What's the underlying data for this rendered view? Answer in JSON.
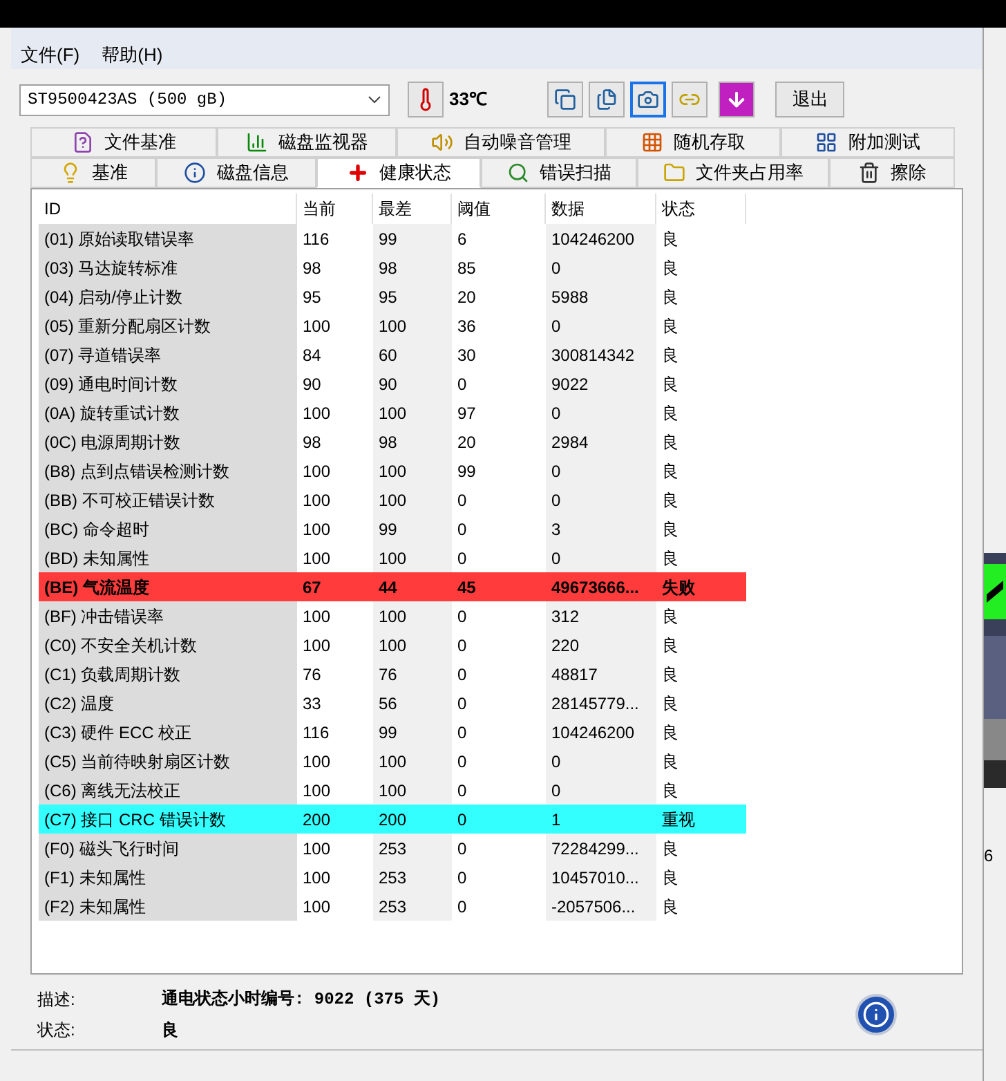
{
  "menu": [
    "文件(F)",
    "帮助(H)"
  ],
  "toolbar": {
    "drive": "ST9500423AS (500 gB)",
    "temperature": "33℃",
    "buttons": [
      {
        "selected": false
      },
      {
        "selected": false
      },
      {
        "selected": true
      },
      {
        "selected": false
      },
      {
        "selected": false
      }
    ],
    "exit": "退出"
  },
  "tabs_back": [
    {
      "label": "文件基准",
      "selected": false
    },
    {
      "label": "磁盘监视器",
      "selected": false
    },
    {
      "label": "自动噪音管理",
      "selected": false
    },
    {
      "label": "随机存取",
      "selected": false
    },
    {
      "label": "附加测试",
      "selected": false
    }
  ],
  "tabs_front": [
    {
      "label": "基准",
      "selected": false
    },
    {
      "label": "磁盘信息",
      "selected": false
    },
    {
      "label": "健康状态",
      "selected": true
    },
    {
      "label": "错误扫描",
      "selected": false
    },
    {
      "label": "文件夹占用率",
      "selected": false
    },
    {
      "label": "擦除",
      "selected": false
    }
  ],
  "table": {
    "columns": [
      "ID",
      "当前",
      "最差",
      "阈值",
      "数据",
      "状态"
    ],
    "rows": [
      {
        "kind": "normal",
        "cells": [
          "(01) 原始读取错误率",
          "116",
          "99",
          "6",
          "104246200",
          "良"
        ]
      },
      {
        "kind": "normal",
        "cells": [
          "(03) 马达旋转标准",
          "98",
          "98",
          "85",
          "0",
          "良"
        ]
      },
      {
        "kind": "normal",
        "cells": [
          "(04) 启动/停止计数",
          "95",
          "95",
          "20",
          "5988",
          "良"
        ]
      },
      {
        "kind": "normal",
        "cells": [
          "(05) 重新分配扇区计数",
          "100",
          "100",
          "36",
          "0",
          "良"
        ]
      },
      {
        "kind": "normal",
        "cells": [
          "(07) 寻道错误率",
          "84",
          "60",
          "30",
          "300814342",
          "良"
        ]
      },
      {
        "kind": "normal",
        "cells": [
          "(09) 通电时间计数",
          "90",
          "90",
          "0",
          "9022",
          "良"
        ]
      },
      {
        "kind": "normal",
        "cells": [
          "(0A) 旋转重试计数",
          "100",
          "100",
          "97",
          "0",
          "良"
        ]
      },
      {
        "kind": "normal",
        "cells": [
          "(0C) 电源周期计数",
          "98",
          "98",
          "20",
          "2984",
          "良"
        ]
      },
      {
        "kind": "normal",
        "cells": [
          "(B8) 点到点错误检测计数",
          "100",
          "100",
          "99",
          "0",
          "良"
        ]
      },
      {
        "kind": "normal",
        "cells": [
          "(BB) 不可校正错误计数",
          "100",
          "100",
          "0",
          "0",
          "良"
        ]
      },
      {
        "kind": "normal",
        "cells": [
          "(BC) 命令超时",
          "100",
          "99",
          "0",
          "3",
          "良"
        ]
      },
      {
        "kind": "normal",
        "cells": [
          "(BD) 未知属性",
          "100",
          "100",
          "0",
          "0",
          "良"
        ]
      },
      {
        "kind": "failed",
        "cells": [
          "(BE) 气流温度",
          "67",
          "44",
          "45",
          "49673666...",
          "失败"
        ]
      },
      {
        "kind": "normal",
        "cells": [
          "(BF) 冲击错误率",
          "100",
          "100",
          "0",
          "312",
          "良"
        ]
      },
      {
        "kind": "normal",
        "cells": [
          "(C0) 不安全关机计数",
          "100",
          "100",
          "0",
          "220",
          "良"
        ]
      },
      {
        "kind": "normal",
        "cells": [
          "(C1) 负载周期计数",
          "76",
          "76",
          "0",
          "48817",
          "良"
        ]
      },
      {
        "kind": "normal",
        "cells": [
          "(C2) 温度",
          "33",
          "56",
          "0",
          "28145779...",
          "良"
        ]
      },
      {
        "kind": "normal",
        "cells": [
          "(C3) 硬件 ECC 校正",
          "116",
          "99",
          "0",
          "104246200",
          "良"
        ]
      },
      {
        "kind": "normal",
        "cells": [
          "(C5) 当前待映射扇区计数",
          "100",
          "100",
          "0",
          "0",
          "良"
        ]
      },
      {
        "kind": "normal",
        "cells": [
          "(C6) 离线无法校正",
          "100",
          "100",
          "0",
          "0",
          "良"
        ]
      },
      {
        "kind": "warning",
        "cells": [
          "(C7) 接口 CRC 错误计数",
          "200",
          "200",
          "0",
          "1",
          "重视"
        ]
      },
      {
        "kind": "normal",
        "cells": [
          "(F0) 磁头飞行时间",
          "100",
          "253",
          "0",
          "72284299...",
          "良"
        ]
      },
      {
        "kind": "normal",
        "cells": [
          "(F1) 未知属性",
          "100",
          "253",
          "0",
          "10457010...",
          "良"
        ]
      },
      {
        "kind": "normal",
        "cells": [
          "(F2) 未知属性",
          "100",
          "253",
          "0",
          "-2057506...",
          "良"
        ]
      }
    ]
  },
  "description": {
    "label": "描述:",
    "value": "通电状态小时编号: 9022 (375 天)"
  },
  "status": {
    "label": "状态:",
    "value": "良"
  },
  "side_text": "6"
}
